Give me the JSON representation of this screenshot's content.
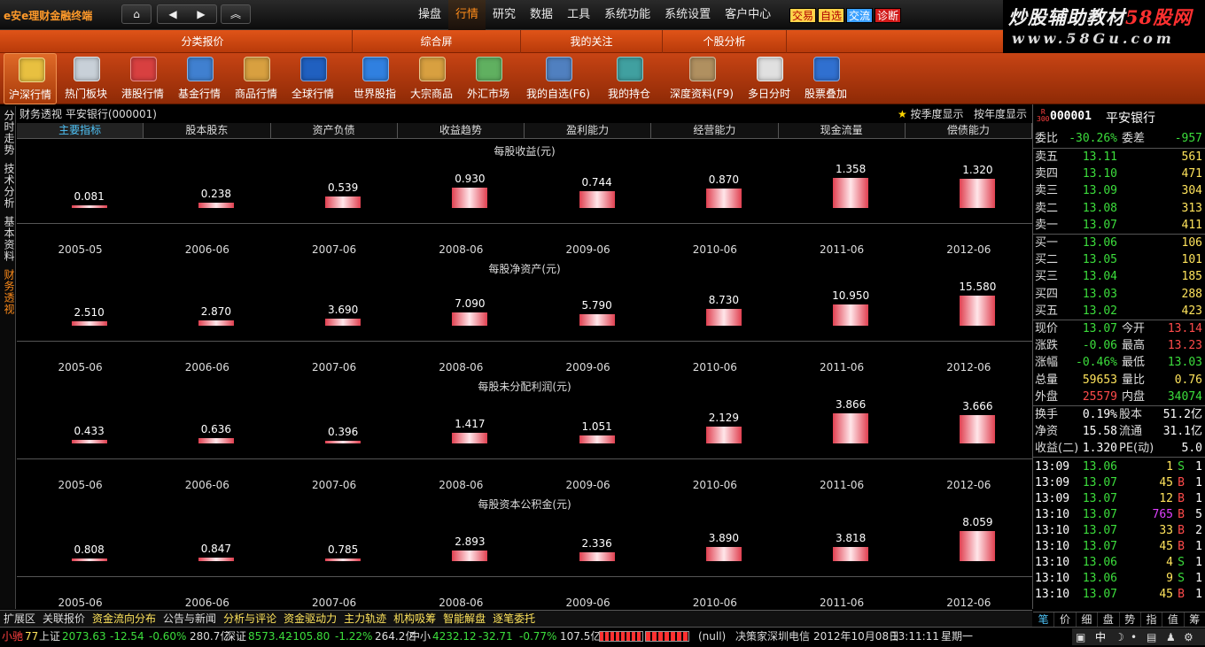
{
  "app": {
    "title": "e安e理财金融终端"
  },
  "menu": [
    "操盘",
    "行情",
    "研究",
    "数据",
    "工具",
    "系统功能",
    "系统设置",
    "客户中心"
  ],
  "menu_active": 1,
  "quick_buttons": [
    {
      "label": "交易",
      "bg": "#ffd24a",
      "fg": "#b00000"
    },
    {
      "label": "自选",
      "bg": "#ffd24a",
      "fg": "#b00000"
    },
    {
      "label": "交流",
      "bg": "#3aa0ff",
      "fg": "#ffffff"
    },
    {
      "label": "诊断",
      "bg": "#d21a1a",
      "fg": "#ffffff"
    }
  ],
  "logo": {
    "line1a": "炒股辅助教材",
    "line1b": "58股网",
    "line2": "www.58Gu.com"
  },
  "categories": [
    "分类报价",
    "综合屏",
    "我的关注",
    "个股分析"
  ],
  "tools": [
    {
      "label": "沪深行情",
      "color": "#e8c040"
    },
    {
      "label": "热门板块",
      "color": "#c8d0d8"
    },
    {
      "label": "港股行情",
      "color": "#d84040"
    },
    {
      "label": "基金行情",
      "color": "#4080d0"
    },
    {
      "label": "商品行情",
      "color": "#d8a040"
    },
    {
      "label": "全球行情",
      "color": "#2060c0"
    },
    {
      "label": "世界股指",
      "color": "#3080e0"
    },
    {
      "label": "大宗商品",
      "color": "#d8a040"
    },
    {
      "label": "外汇市场",
      "color": "#60b060"
    },
    {
      "label": "我的自选(F6)",
      "color": "#5080c0"
    },
    {
      "label": "我的持仓",
      "color": "#40a0a0"
    },
    {
      "label": "深度资料(F9)",
      "color": "#b09060"
    },
    {
      "label": "多日分时",
      "color": "#e0e0e0"
    },
    {
      "label": "股票叠加",
      "color": "#3070d0"
    }
  ],
  "side_tabs": [
    "分时走势",
    "技术分析",
    "基本资料",
    "财务透视"
  ],
  "side_active": 3,
  "main": {
    "title": "财务透视  平安银行(000001)",
    "options": [
      "按季度显示",
      "按年度显示"
    ],
    "tabs": [
      "主要指标",
      "股本股东",
      "资产负债",
      "收益趋势",
      "盈利能力",
      "经营能力",
      "现金流量",
      "偿债能力"
    ],
    "tab_active": 0
  },
  "chart_data": [
    {
      "type": "bar",
      "title": "每股收益(元)",
      "categories": [
        "2005-05",
        "2006-06",
        "2007-06",
        "2008-06",
        "2009-06",
        "2010-06",
        "2011-06",
        "2012-06"
      ],
      "values": [
        0.081,
        0.238,
        0.539,
        0.93,
        0.744,
        0.87,
        1.358,
        1.32
      ],
      "labels": [
        "0.081",
        "0.238",
        "0.539",
        "0.930",
        "0.744",
        "0.870",
        "1.358",
        "1.320"
      ]
    },
    {
      "type": "bar",
      "title": "每股净资产(元)",
      "categories": [
        "2005-06",
        "2006-06",
        "2007-06",
        "2008-06",
        "2009-06",
        "2010-06",
        "2011-06",
        "2012-06"
      ],
      "values": [
        2.51,
        2.87,
        3.69,
        7.09,
        5.79,
        8.73,
        10.95,
        15.58
      ],
      "labels": [
        "2.510",
        "2.870",
        "3.690",
        "7.090",
        "5.790",
        "8.730",
        "10.950",
        "15.580"
      ]
    },
    {
      "type": "bar",
      "title": "每股未分配利润(元)",
      "categories": [
        "2005-06",
        "2006-06",
        "2007-06",
        "2008-06",
        "2009-06",
        "2010-06",
        "2011-06",
        "2012-06"
      ],
      "values": [
        0.433,
        0.636,
        0.396,
        1.417,
        1.051,
        2.129,
        3.866,
        3.666
      ],
      "labels": [
        "0.433",
        "0.636",
        "0.396",
        "1.417",
        "1.051",
        "2.129",
        "3.866",
        "3.666"
      ]
    },
    {
      "type": "bar",
      "title": "每股资本公积金(元)",
      "categories": [
        "2005-06",
        "2006-06",
        "2007-06",
        "2008-06",
        "2009-06",
        "2010-06",
        "2011-06",
        "2012-06"
      ],
      "values": [
        0.808,
        0.847,
        0.785,
        2.893,
        2.336,
        3.89,
        3.818,
        8.059
      ],
      "labels": [
        "0.808",
        "0.847",
        "0.785",
        "2.893",
        "2.336",
        "3.890",
        "3.818",
        "8.059"
      ]
    }
  ],
  "stock": {
    "badge_top": "R",
    "badge_bottom": "300",
    "code": "000001",
    "name": "平安银行",
    "weibi": {
      "l1": "委比",
      "v1": "-30.26%",
      "l2": "委差",
      "v2": "-957"
    },
    "sell": [
      {
        "label": "卖五",
        "price": "13.11",
        "vol": "561"
      },
      {
        "label": "卖四",
        "price": "13.10",
        "vol": "471"
      },
      {
        "label": "卖三",
        "price": "13.09",
        "vol": "304"
      },
      {
        "label": "卖二",
        "price": "13.08",
        "vol": "313"
      },
      {
        "label": "卖一",
        "price": "13.07",
        "vol": "411"
      }
    ],
    "buy": [
      {
        "label": "买一",
        "price": "13.06",
        "vol": "106"
      },
      {
        "label": "买二",
        "price": "13.05",
        "vol": "101"
      },
      {
        "label": "买三",
        "price": "13.04",
        "vol": "185"
      },
      {
        "label": "买四",
        "price": "13.03",
        "vol": "288"
      },
      {
        "label": "买五",
        "price": "13.02",
        "vol": "423"
      }
    ],
    "quote": [
      {
        "l1": "现价",
        "v1": "13.07",
        "c1": "g",
        "l2": "今开",
        "v2": "13.14",
        "c2": "r"
      },
      {
        "l1": "涨跌",
        "v1": "-0.06",
        "c1": "g",
        "l2": "最高",
        "v2": "13.23",
        "c2": "r"
      },
      {
        "l1": "涨幅",
        "v1": "-0.46%",
        "c1": "g",
        "l2": "最低",
        "v2": "13.03",
        "c2": "g"
      },
      {
        "l1": "总量",
        "v1": "59653",
        "c1": "y",
        "l2": "量比",
        "v2": "0.76",
        "c2": "y"
      },
      {
        "l1": "外盘",
        "v1": "25579",
        "c1": "r",
        "l2": "内盘",
        "v2": "34074",
        "c2": "g"
      }
    ],
    "fund": [
      {
        "l1": "换手",
        "v1": "0.19%",
        "l2": "股本",
        "v2": "51.2亿"
      },
      {
        "l1": "净资",
        "v1": "15.58",
        "l2": "流通",
        "v2": "31.1亿"
      },
      {
        "l1": "收益(二)",
        "v1": "1.320",
        "l2": "PE(动)",
        "v2": "5.0"
      }
    ],
    "ticks": [
      {
        "time": "13:09",
        "price": "13.06",
        "vol": "1",
        "bs": "S",
        "n": "1"
      },
      {
        "time": "13:09",
        "price": "13.07",
        "vol": "45",
        "bs": "B",
        "n": "1"
      },
      {
        "time": "13:09",
        "price": "13.07",
        "vol": "12",
        "bs": "B",
        "n": "1"
      },
      {
        "time": "13:10",
        "price": "13.07",
        "vol": "765",
        "bs": "B",
        "n": "5"
      },
      {
        "time": "13:10",
        "price": "13.07",
        "vol": "33",
        "bs": "B",
        "n": "2"
      },
      {
        "time": "13:10",
        "price": "13.07",
        "vol": "45",
        "bs": "B",
        "n": "1"
      },
      {
        "time": "13:10",
        "price": "13.06",
        "vol": "4",
        "bs": "S",
        "n": "1"
      },
      {
        "time": "13:10",
        "price": "13.06",
        "vol": "9",
        "bs": "S",
        "n": "1"
      },
      {
        "time": "13:10",
        "price": "13.07",
        "vol": "45",
        "bs": "B",
        "n": "1"
      }
    ],
    "tabs": [
      "笔",
      "价",
      "细",
      "盘",
      "势",
      "指",
      "值",
      "筹"
    ]
  },
  "bottom_tabs": [
    "扩展区",
    "关联报价",
    "资金流向分布",
    "公告与新闻",
    "分析与评论",
    "资金驱动力",
    "主力轨迹",
    "机构吸筹",
    "智能解盘",
    "逐笔委托"
  ],
  "status": {
    "assistant": "小驰",
    "count": "77",
    "sh_label": "上证",
    "sh_index": "2073.63",
    "sh_change": "-12.54",
    "sh_pct": "-0.60%",
    "sh_amount": "280.7亿",
    "sz_label": "深证",
    "sz_index": "8573.42",
    "sz_change": "-105.80",
    "sz_pct": "-1.22%",
    "sz_amount": "264.2亿",
    "zx_label": "中小",
    "zx_index": "4232.12",
    "zx_change": "-32.71",
    "zx_pct": "-0.77%",
    "zx_amount": "107.5亿",
    "null_text": "(null)",
    "news": "决策家深圳电信",
    "date": "2012年10月08日",
    "time": "13:11:11",
    "weekday": "星期一"
  }
}
